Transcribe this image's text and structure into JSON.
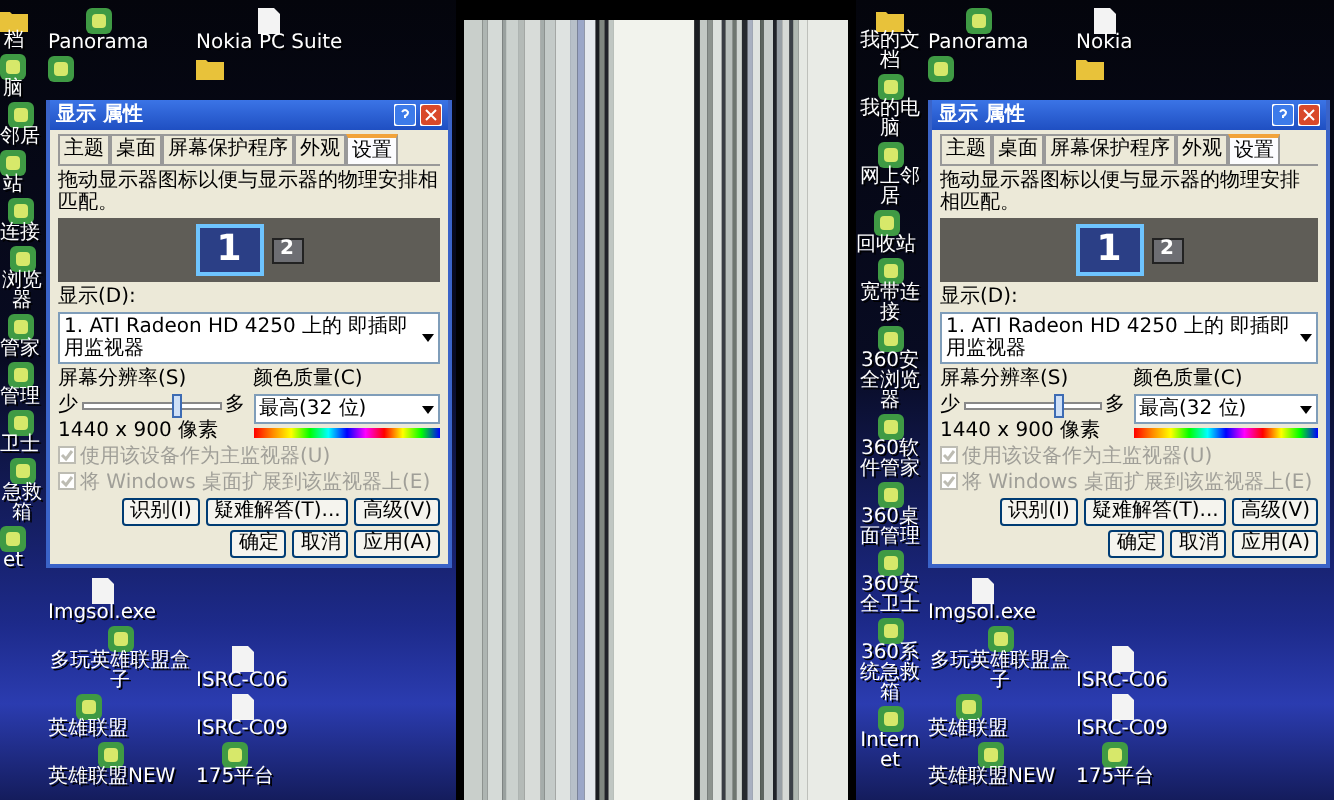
{
  "screens": [
    {
      "icon_columns": [
        {
          "top": [
            {
              "label": "档",
              "kind": "folder"
            },
            {
              "label": "脑",
              "kind": "app"
            },
            {
              "label": "邻居",
              "kind": "app"
            },
            {
              "label": "站",
              "kind": "app"
            },
            {
              "label": "连接",
              "kind": "app"
            },
            {
              "label": "浏览器",
              "kind": "app"
            },
            {
              "label": "管家",
              "kind": "app"
            },
            {
              "label": "管理",
              "kind": "app"
            },
            {
              "label": "卫士",
              "kind": "app"
            },
            {
              "label": "急救箱",
              "kind": "app"
            },
            {
              "label": "et",
              "kind": "app"
            }
          ]
        },
        {
          "top": [
            {
              "label": "Panorama",
              "kind": "app"
            },
            {
              "kind": "app"
            }
          ],
          "bottom": [
            {
              "label": "Imgsol.exe",
              "kind": "document"
            },
            {
              "label": "多玩英雄联盟盒子",
              "kind": "app"
            },
            {
              "label": "英雄联盟",
              "kind": "app"
            },
            {
              "label": "英雄联盟NEW",
              "kind": "app"
            }
          ]
        },
        {
          "top": [
            {
              "label": "Nokia PC Suite",
              "kind": "document"
            },
            {
              "kind": "folder"
            }
          ],
          "bottom": [
            {
              "label": "ISRC-C06",
              "kind": "document"
            },
            {
              "label": "ISRC-C09",
              "kind": "document"
            },
            {
              "label": "175平台",
              "kind": "app"
            }
          ]
        }
      ],
      "dialog": {
        "title": "显示 属性",
        "tabs": [
          {
            "label": "主题",
            "selected": false
          },
          {
            "label": "桌面",
            "selected": false
          },
          {
            "label": "屏幕保护程序",
            "selected": false
          },
          {
            "label": "外观",
            "selected": false
          },
          {
            "label": "设置",
            "selected": true
          }
        ],
        "instruction": "拖动显示器图标以便与显示器的物理安排相匹配。",
        "monitors": [
          {
            "label": "1",
            "selected": true
          },
          {
            "label": "2",
            "selected": false
          }
        ],
        "display_label": "显示(D):",
        "display_value": "1. ATI Radeon HD 4250 上的 即插即用监视器",
        "resolution": {
          "label": "屏幕分辨率(S)",
          "min_label": "少",
          "max_label": "多",
          "level": 0.7,
          "reading": "1440 x 900 像素"
        },
        "color_quality": {
          "label": "颜色质量(C)",
          "value": "最高(32 位)"
        },
        "checkboxes": [
          {
            "label": "使用该设备作为主监视器(U)",
            "checked": true,
            "disabled": true
          },
          {
            "label": "将 Windows 桌面扩展到该监视器上(E)",
            "checked": true,
            "disabled": true
          }
        ],
        "buttons": [
          "识别(I)",
          "疑难解答(T)...",
          "高级(V)"
        ],
        "footer_buttons": [
          "确定",
          "取消",
          "应用(A)"
        ]
      }
    },
    {
      "icon_columns": [
        {
          "top": [
            {
              "label": "我的文档",
              "kind": "folder"
            },
            {
              "label": "我的电脑",
              "kind": "app"
            },
            {
              "label": "网上邻居",
              "kind": "app"
            },
            {
              "label": "回收站",
              "kind": "app"
            },
            {
              "label": "宽带连接",
              "kind": "app"
            },
            {
              "label": "360安全浏览器",
              "kind": "app"
            },
            {
              "label": "360软件管家",
              "kind": "app"
            },
            {
              "label": "360桌面管理",
              "kind": "app"
            },
            {
              "label": "360安全卫士",
              "kind": "app"
            },
            {
              "label": "360系统急救箱",
              "kind": "app"
            },
            {
              "label": "Internet",
              "kind": "app"
            }
          ]
        },
        {
          "top": [
            {
              "label": "Panorama",
              "kind": "app"
            },
            {
              "kind": "app"
            }
          ],
          "bottom": [
            {
              "label": "Imgsol.exe",
              "kind": "document"
            },
            {
              "label": "多玩英雄联盟盒子",
              "kind": "app"
            },
            {
              "label": "英雄联盟",
              "kind": "app"
            },
            {
              "label": "英雄联盟NEW",
              "kind": "app"
            }
          ]
        },
        {
          "top": [
            {
              "label": "Nokia",
              "kind": "document"
            },
            {
              "kind": "folder"
            }
          ],
          "bottom": [
            {
              "label": "ISRC-C06",
              "kind": "document"
            },
            {
              "label": "ISRC-C09",
              "kind": "document"
            },
            {
              "label": "175平台",
              "kind": "app"
            }
          ]
        }
      ],
      "dialog": {
        "title": "显示 属性",
        "tabs": [
          {
            "label": "主题",
            "selected": false
          },
          {
            "label": "桌面",
            "selected": false
          },
          {
            "label": "屏幕保护程序",
            "selected": false
          },
          {
            "label": "外观",
            "selected": false
          },
          {
            "label": "设置",
            "selected": true
          }
        ],
        "instruction": "拖动显示器图标以便与显示器的物理安排相匹配。",
        "monitors": [
          {
            "label": "1",
            "selected": true
          },
          {
            "label": "2",
            "selected": false
          }
        ],
        "display_label": "显示(D):",
        "display_value": "1. ATI Radeon HD 4250 上的 即插即用监视器",
        "resolution": {
          "label": "屏幕分辨率(S)",
          "min_label": "少",
          "max_label": "多",
          "level": 0.7,
          "reading": "1440 x 900 像素"
        },
        "color_quality": {
          "label": "颜色质量(C)",
          "value": "最高(32 位)"
        },
        "checkboxes": [
          {
            "label": "使用该设备作为主监视器(U)",
            "checked": true,
            "disabled": true
          },
          {
            "label": "将 Windows 桌面扩展到该监视器上(E)",
            "checked": true,
            "disabled": true
          }
        ],
        "buttons": [
          "识别(I)",
          "疑难解答(T)...",
          "高级(V)"
        ],
        "footer_buttons": [
          "确定",
          "取消",
          "应用(A)"
        ]
      }
    }
  ]
}
